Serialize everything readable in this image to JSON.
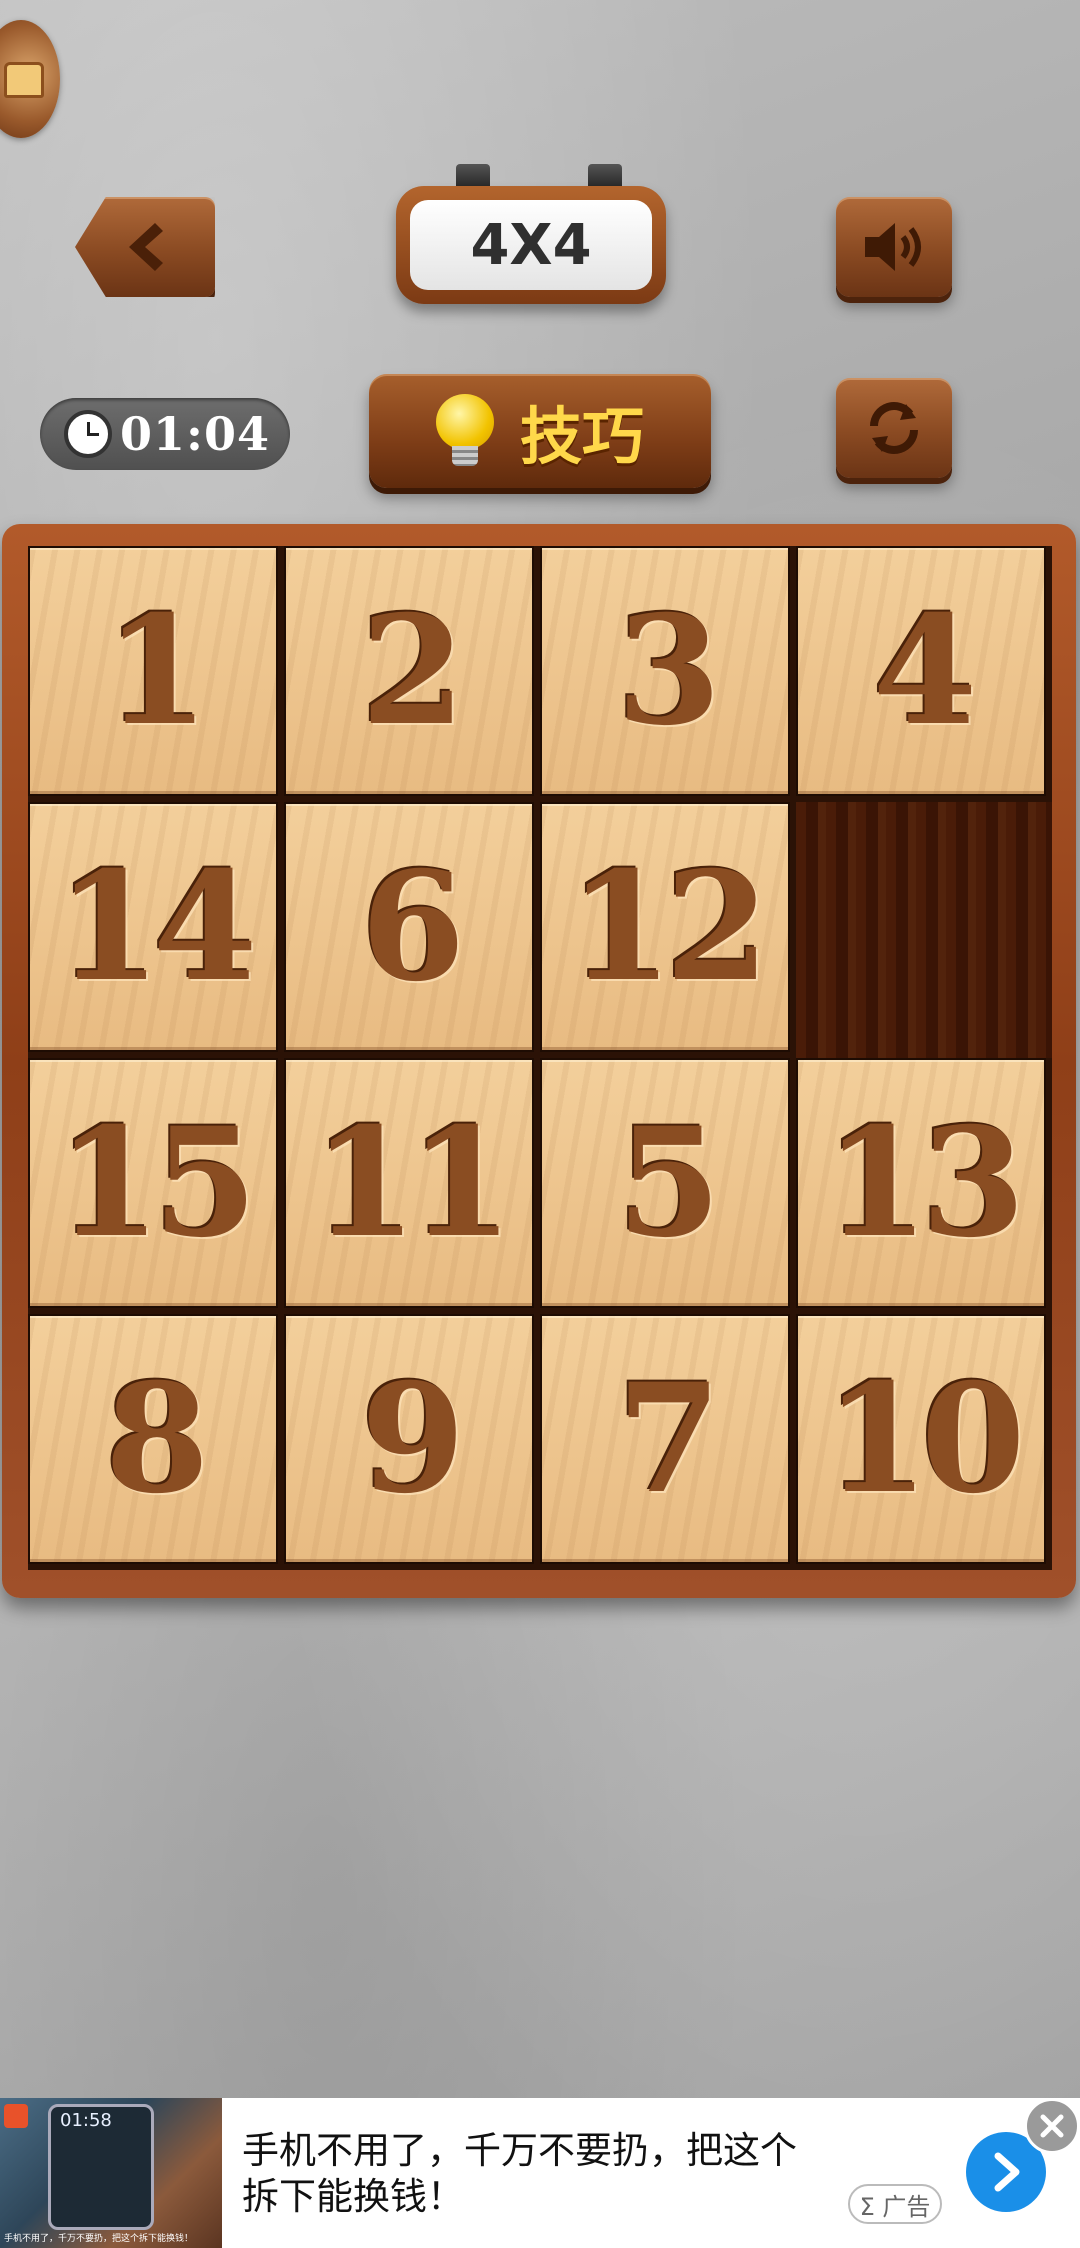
{
  "header": {
    "title": "4X4",
    "timer": "01:04",
    "tips_label": "技巧"
  },
  "icons": {
    "back": "chevron-left-icon",
    "sound": "speaker-icon",
    "refresh": "refresh-icon",
    "tips": "lightbulb-icon",
    "clock": "clock-icon",
    "chest": "treasure-chest-icon"
  },
  "board": {
    "size": "4x4",
    "tiles": [
      [
        "1",
        "2",
        "3",
        "4"
      ],
      [
        "14",
        "6",
        "12",
        null
      ],
      [
        "15",
        "11",
        "5",
        "13"
      ],
      [
        "8",
        "9",
        "7",
        "10"
      ]
    ]
  },
  "ad": {
    "text": "手机不用了，千万不要扔，把这个拆下能换钱！",
    "label": "Σ 广告",
    "thumb_time": "01:58",
    "thumb_caption": "手机不用了，千万不要扔，把这个拆下能换钱！"
  },
  "colors": {
    "wood_dark": "#7e3d17",
    "tile_light": "#f3cf9b",
    "digit": "#8a4d22",
    "tips_text": "#ffd84a",
    "ad_button": "#1a8fe8"
  }
}
